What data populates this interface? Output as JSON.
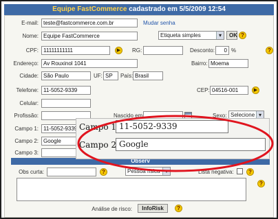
{
  "title": {
    "prefix": "Equipe FastCommerce",
    "middle": " cadastrado em ",
    "date": "5/5/2009 12:54"
  },
  "fields": {
    "email": {
      "label": "E-mail:",
      "value": "teste@fastcommerce.com.br",
      "link": "Mudar senha"
    },
    "nome": {
      "label": "Nome:",
      "value": "Equipe FastCommerce",
      "select": "Etiqueta simples",
      "button": "OK"
    },
    "cpf": {
      "label": "CPF:",
      "value": "11111111111"
    },
    "rg": {
      "label": "RG:",
      "value": ""
    },
    "desconto": {
      "label": "Desconto:",
      "value": "0",
      "unit": "%"
    },
    "endereco": {
      "label": "Endereço:",
      "value": "Av Rouxinol 1041"
    },
    "bairro": {
      "label": "Bairro:",
      "value": "Moema"
    },
    "cidade": {
      "label": "Cidade:",
      "value": "São Paulo"
    },
    "uf": {
      "label": "UF:",
      "value": "SP"
    },
    "pais": {
      "label": "País:",
      "value": "Brasil"
    },
    "telefone": {
      "label": "Telefone:",
      "value": "11-5052-9339"
    },
    "cep": {
      "label": "CEP:",
      "value": "04516-001"
    },
    "celular": {
      "label": "Celular:",
      "value": ""
    },
    "profissao": {
      "label": "Profissão:",
      "value": ""
    },
    "nascido": {
      "label": "Nascido em:",
      "value": ""
    },
    "sexo": {
      "label": "Sexo:",
      "value": "Selecione"
    },
    "campo1": {
      "label": "Campo 1:",
      "value": "11-5052-9339"
    },
    "campo2": {
      "label": "Campo 2:",
      "value": "Google"
    },
    "campo3": {
      "label": "Campo 3:",
      "value": ""
    }
  },
  "observacoes": {
    "header": "Observ",
    "obs_curta_label": "Obs curta:",
    "obs_curta_value": "",
    "pessoa_select": "Pessoa física",
    "lista_negativa_label": "Lista negativa:",
    "analise_label": "Análise de risco:",
    "inforisk_button": "InfoRisk"
  },
  "zoom": {
    "campo1_label": "Campo 1:",
    "campo1_value": "11-5052-9339",
    "campo2_label": "Campo 2:",
    "campo2_value": "Google"
  },
  "icons": {
    "arrow": "arrow-right-icon",
    "help": "help-icon",
    "calendar": "calendar-icon"
  },
  "colors": {
    "title_bar": "#3e6aa6",
    "title_accent": "#ffd24a",
    "highlight_ellipse": "#e0141e",
    "icon_yellow": "#f5c800"
  }
}
